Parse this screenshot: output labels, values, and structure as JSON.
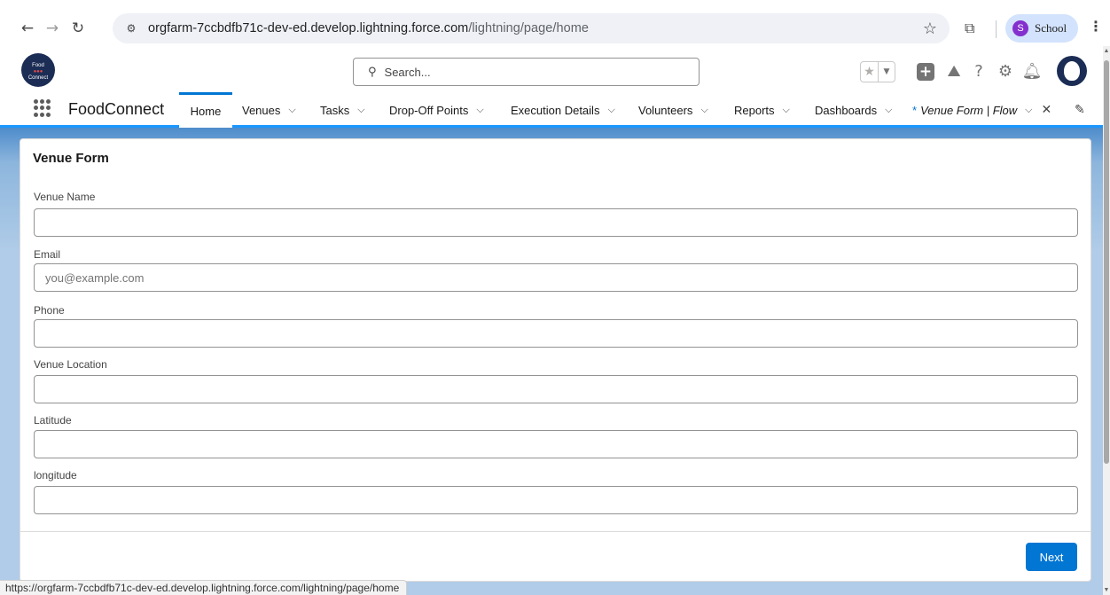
{
  "browser": {
    "url_main": "orgfarm-7ccbdfb71c-dev-ed.develop.lightning.force.com",
    "url_path": "/lightning/page/home",
    "profile_initial": "S",
    "profile_name": "School"
  },
  "header": {
    "logo_text_top": "Food",
    "logo_text_bottom": "Connect",
    "search_placeholder": "Search..."
  },
  "nav": {
    "app_name": "FoodConnect",
    "items": [
      {
        "label": "Home"
      },
      {
        "label": "Venues"
      },
      {
        "label": "Tasks"
      },
      {
        "label": "Drop-Off Points"
      },
      {
        "label": "Execution Details"
      },
      {
        "label": "Volunteers"
      },
      {
        "label": "Reports"
      },
      {
        "label": "Dashboards"
      }
    ],
    "active_tab": {
      "prefix": "*",
      "label": "Venue Form | Flow"
    }
  },
  "form": {
    "title": "Venue Form",
    "fields": [
      {
        "label": "Venue Name",
        "value": "",
        "placeholder": ""
      },
      {
        "label": "Email",
        "value": "",
        "placeholder": "you@example.com"
      },
      {
        "label": "Phone",
        "value": "",
        "placeholder": ""
      },
      {
        "label": "Venue Location",
        "value": "",
        "placeholder": ""
      },
      {
        "label": "Latitude",
        "value": "",
        "placeholder": ""
      },
      {
        "label": "longitude",
        "value": "",
        "placeholder": ""
      }
    ],
    "next_label": "Next"
  },
  "status_bar": {
    "url": "https://orgfarm-7ccbdfb71c-dev-ed.develop.lightning.force.com/lightning/page/home"
  },
  "colors": {
    "brand_blue": "#0176d3",
    "nav_accent": "#1b96ff",
    "background_top": "#4e8ccb",
    "background": "#b0cce8"
  },
  "icons": [
    "back-icon",
    "forward-icon",
    "reload-icon",
    "site-info-icon",
    "bookmark-star-icon",
    "extensions-icon",
    "kebab-menu-icon",
    "search-icon",
    "favorites-star-icon",
    "favorites-dropdown-icon",
    "global-actions-icon",
    "trailhead-icon",
    "help-icon",
    "setup-gear-icon",
    "notifications-bell-icon",
    "chevron-down-icon",
    "close-icon",
    "edit-pencil-icon"
  ]
}
